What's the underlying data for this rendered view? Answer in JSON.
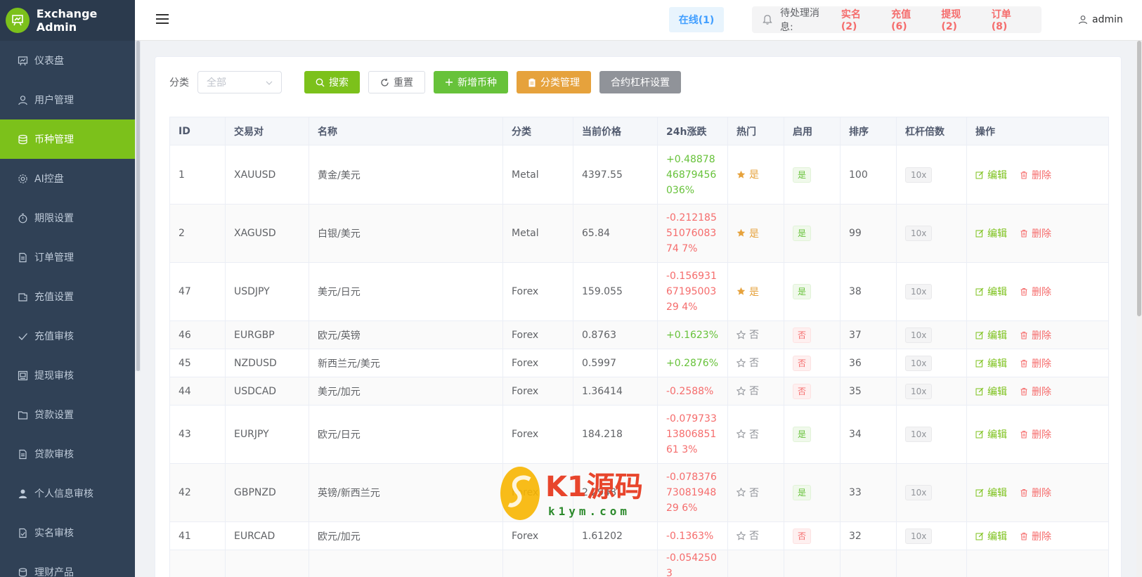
{
  "brand": {
    "title": "Exchange Admin"
  },
  "sidebar": {
    "items": [
      {
        "label": "仪表盘",
        "icon": "dashboard-icon"
      },
      {
        "label": "用户管理",
        "icon": "user-icon"
      },
      {
        "label": "币种管理",
        "icon": "database-icon",
        "active": true
      },
      {
        "label": "AI控盘",
        "icon": "gear-icon"
      },
      {
        "label": "期限设置",
        "icon": "timer-icon"
      },
      {
        "label": "订单管理",
        "icon": "document-icon"
      },
      {
        "label": "充值设置",
        "icon": "wallet-icon"
      },
      {
        "label": "充值审核",
        "icon": "check-icon"
      },
      {
        "label": "提现审核",
        "icon": "withdraw-icon"
      },
      {
        "label": "贷款设置",
        "icon": "folder-icon"
      },
      {
        "label": "贷款审核",
        "icon": "document-icon"
      },
      {
        "label": "个人信息审核",
        "icon": "person-icon"
      },
      {
        "label": "实名审核",
        "icon": "doc-check-icon"
      },
      {
        "label": "理财产品",
        "icon": "coins-icon"
      }
    ]
  },
  "header": {
    "online": "在线(1)",
    "notice_label": "待处理消息:",
    "notices": [
      "实名(2)",
      "充值(6)",
      "提现(2)",
      "订单(8)"
    ],
    "user": "admin"
  },
  "toolbar": {
    "category_label": "分类",
    "category_placeholder": "全部",
    "search": "搜索",
    "reset": "重置",
    "add": "新增币种",
    "category_manage": "分类管理",
    "leverage_settings": "合约杠杆设置"
  },
  "table": {
    "columns": [
      "ID",
      "交易对",
      "名称",
      "分类",
      "当前价格",
      "24h涨跌",
      "热门",
      "启用",
      "排序",
      "杠杆倍数",
      "操作"
    ],
    "edit_label": "编辑",
    "delete_label": "删除",
    "rows": [
      {
        "id": "1",
        "pair": "XAUUSD",
        "name": "黄金/美元",
        "category": "Metal",
        "price": "4397.55",
        "change": "+0.4887846879456036%",
        "dir": "up",
        "hot": "是",
        "hot_on": true,
        "enabled": "是",
        "enabled_on": true,
        "sort": "100",
        "leverage": "10x"
      },
      {
        "id": "2",
        "pair": "XAGUSD",
        "name": "白银/美元",
        "category": "Metal",
        "price": "65.84",
        "change": "-0.2121855107608374 7%",
        "dir": "down",
        "hot": "是",
        "hot_on": true,
        "enabled": "是",
        "enabled_on": true,
        "sort": "99",
        "leverage": "10x"
      },
      {
        "id": "47",
        "pair": "USDJPY",
        "name": "美元/日元",
        "category": "Forex",
        "price": "159.055",
        "change": "-0.1569316719500329 4%",
        "dir": "down",
        "hot": "是",
        "hot_on": true,
        "enabled": "是",
        "enabled_on": true,
        "sort": "38",
        "leverage": "10x"
      },
      {
        "id": "46",
        "pair": "EURGBP",
        "name": "欧元/英镑",
        "category": "Forex",
        "price": "0.8763",
        "change": "+0.1623%",
        "dir": "up",
        "hot": "否",
        "hot_on": false,
        "enabled": "否",
        "enabled_on": false,
        "sort": "37",
        "leverage": "10x"
      },
      {
        "id": "45",
        "pair": "NZDUSD",
        "name": "新西兰元/美元",
        "category": "Forex",
        "price": "0.5997",
        "change": "+0.2876%",
        "dir": "up",
        "hot": "否",
        "hot_on": false,
        "enabled": "否",
        "enabled_on": false,
        "sort": "36",
        "leverage": "10x"
      },
      {
        "id": "44",
        "pair": "USDCAD",
        "name": "美元/加元",
        "category": "Forex",
        "price": "1.36414",
        "change": "-0.2588%",
        "dir": "down",
        "hot": "否",
        "hot_on": false,
        "enabled": "否",
        "enabled_on": false,
        "sort": "35",
        "leverage": "10x"
      },
      {
        "id": "43",
        "pair": "EURJPY",
        "name": "欧元/日元",
        "category": "Forex",
        "price": "184.218",
        "change": "-0.0797331380685161 3%",
        "dir": "down",
        "hot": "否",
        "hot_on": false,
        "enabled": "是",
        "enabled_on": true,
        "sort": "34",
        "leverage": "10x"
      },
      {
        "id": "42",
        "pair": "GBPNZD",
        "name": "英镑/新西兰元",
        "category": "Forex",
        "price": "2.2948",
        "change": "-0.0783767308194829 6%",
        "dir": "down",
        "hot": "否",
        "hot_on": false,
        "enabled": "是",
        "enabled_on": true,
        "sort": "33",
        "leverage": "10x"
      },
      {
        "id": "41",
        "pair": "EURCAD",
        "name": "欧元/加元",
        "category": "Forex",
        "price": "1.61202",
        "change": "-0.1363%",
        "dir": "down",
        "hot": "否",
        "hot_on": false,
        "enabled": "否",
        "enabled_on": false,
        "sort": "32",
        "leverage": "10x"
      },
      {
        "id": "",
        "pair": "",
        "name": "",
        "category": "",
        "price": "",
        "change": "-0.0542503",
        "dir": "down",
        "hot": "",
        "hot_on": false,
        "enabled": "",
        "enabled_on": false,
        "sort": "",
        "leverage": ""
      }
    ]
  },
  "watermark": {
    "text": "K1源码",
    "sub": "k1ym.com"
  },
  "colors": {
    "accent": "#7cc11b",
    "sidebar": "#304156",
    "up": "#67c23a",
    "down": "#f56c6c"
  }
}
